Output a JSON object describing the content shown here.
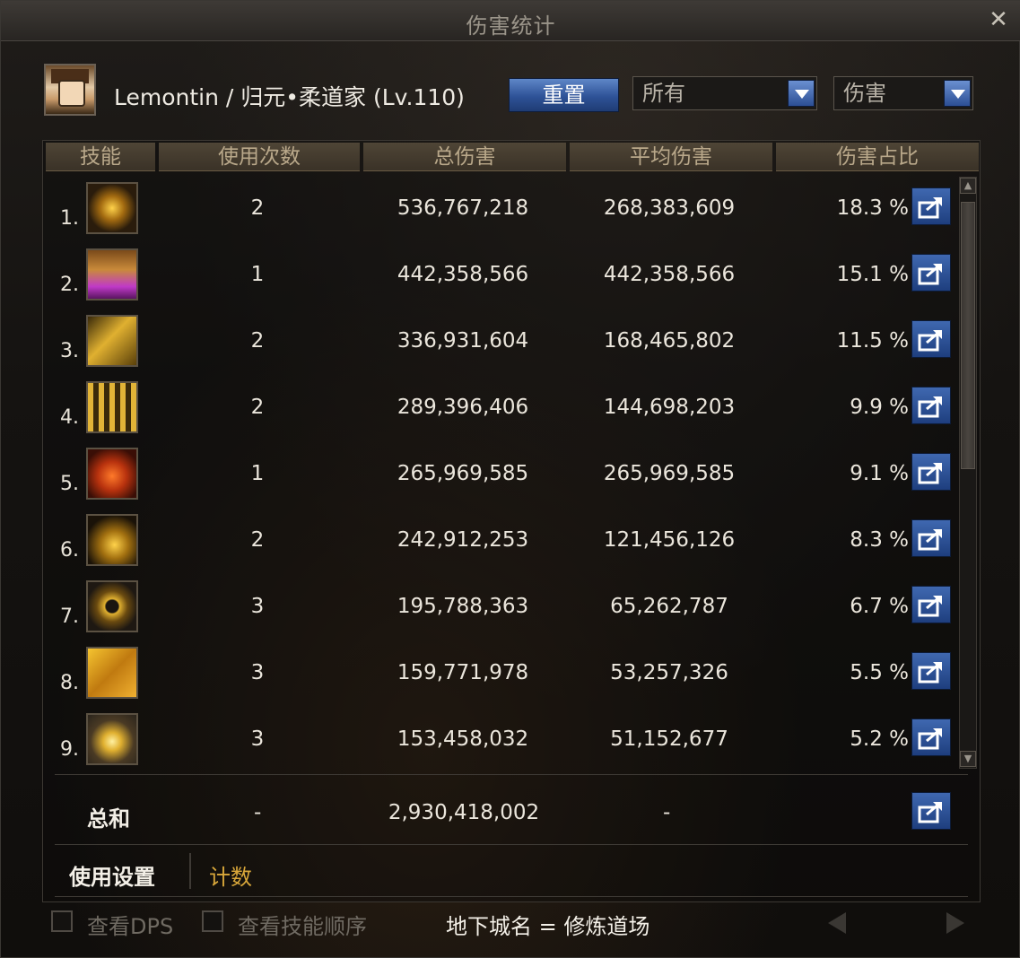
{
  "window": {
    "title": "伤害统计",
    "close_icon": "✕"
  },
  "player": {
    "label": "Lemontin / 归元•柔道家 (Lv.110)"
  },
  "controls": {
    "reset_label": "重置",
    "filter_select": "所有",
    "type_select": "伤害"
  },
  "table": {
    "headers": [
      "技能",
      "使用次数",
      "总伤害",
      "平均伤害",
      "伤害占比"
    ],
    "rows": [
      {
        "rank": "1.",
        "uses": "2",
        "total": "536,767,218",
        "avg": "268,383,609",
        "pct": "18.3 %",
        "icon": "skill-icon-yellow-figure"
      },
      {
        "rank": "2.",
        "uses": "1",
        "total": "442,358,566",
        "avg": "442,358,566",
        "pct": "15.1 %",
        "icon": "skill-icon-purple-flames"
      },
      {
        "rank": "3.",
        "uses": "2",
        "total": "336,931,604",
        "avg": "168,465,802",
        "pct": "11.5 %",
        "icon": "skill-icon-gold-kick"
      },
      {
        "rank": "4.",
        "uses": "2",
        "total": "289,396,406",
        "avg": "144,698,203",
        "pct": "9.9 %",
        "icon": "skill-icon-gold-spikes"
      },
      {
        "rank": "5.",
        "uses": "1",
        "total": "265,969,585",
        "avg": "265,969,585",
        "pct": "9.1 %",
        "icon": "skill-icon-red-glyph"
      },
      {
        "rank": "6.",
        "uses": "2",
        "total": "242,912,253",
        "avg": "121,456,126",
        "pct": "8.3 %",
        "icon": "skill-icon-gold-burst"
      },
      {
        "rank": "7.",
        "uses": "3",
        "total": "195,788,363",
        "avg": "65,262,787",
        "pct": "6.7 %",
        "icon": "skill-icon-vortex"
      },
      {
        "rank": "8.",
        "uses": "3",
        "total": "159,771,978",
        "avg": "53,257,326",
        "pct": "5.5 %",
        "icon": "skill-icon-gold-strike"
      },
      {
        "rank": "9.",
        "uses": "3",
        "total": "153,458,032",
        "avg": "51,152,677",
        "pct": "5.2 %",
        "icon": "skill-icon-explosion"
      }
    ]
  },
  "totals": {
    "label": "总和",
    "uses": "-",
    "total": "2,930,418,002",
    "avg": "-"
  },
  "tabs": {
    "settings": "使用设置",
    "count": "计数"
  },
  "footer": {
    "view_dps": "查看DPS",
    "view_skill_order": "查看技能顺序",
    "dungeon": "地下城名 = 修炼道场"
  },
  "colors": {
    "accent_blue": "#2e5297",
    "header_gold": "#b9a88a",
    "tab_active_gold": "#d9a73a"
  }
}
